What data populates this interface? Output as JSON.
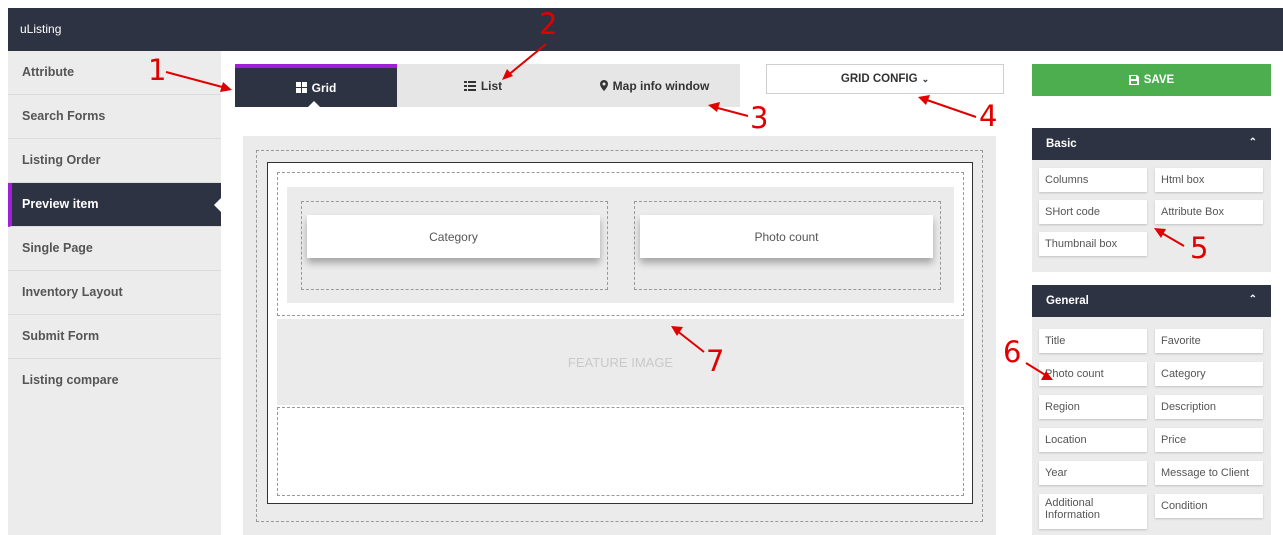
{
  "app": {
    "title": "uListing"
  },
  "sidebar": {
    "items": [
      {
        "label": "Attribute"
      },
      {
        "label": "Search Forms"
      },
      {
        "label": "Listing Order"
      },
      {
        "label": "Preview item",
        "active": true
      },
      {
        "label": "Single Page"
      },
      {
        "label": "Inventory Layout"
      },
      {
        "label": "Submit Form"
      },
      {
        "label": "Listing compare"
      }
    ]
  },
  "tabs": [
    {
      "label": "Grid",
      "icon": "grid-icon",
      "active": true
    },
    {
      "label": "List",
      "icon": "list-icon"
    },
    {
      "label": "Map info window",
      "icon": "map-marker-icon"
    }
  ],
  "grid_config": {
    "label": "GRID CONFIG",
    "icon": "chevron-down-icon"
  },
  "canvas": {
    "columns": [
      {
        "label": "Category"
      },
      {
        "label": "Photo count"
      }
    ],
    "feature_image": "FEATURE IMAGE"
  },
  "save": {
    "label": "SAVE",
    "icon": "floppy-icon",
    "color": "#4cae4f"
  },
  "basic_panel": {
    "title": "Basic",
    "items": [
      "Columns",
      "Html box",
      "SHort code",
      "Attribute Box",
      "Thumbnail box"
    ]
  },
  "general_panel": {
    "title": "General",
    "items": [
      "Title",
      "Favorite",
      "Photo count",
      "Category",
      "Region",
      "Description",
      "Location",
      "Price",
      "Year",
      "Message to Client",
      "Additional Information",
      "Condition"
    ]
  },
  "annotations": [
    "1",
    "2",
    "3",
    "4",
    "5",
    "6",
    "7"
  ],
  "colors": {
    "dark": "#2e3343",
    "accent": "#a020d8",
    "annotation": "#e00000"
  }
}
